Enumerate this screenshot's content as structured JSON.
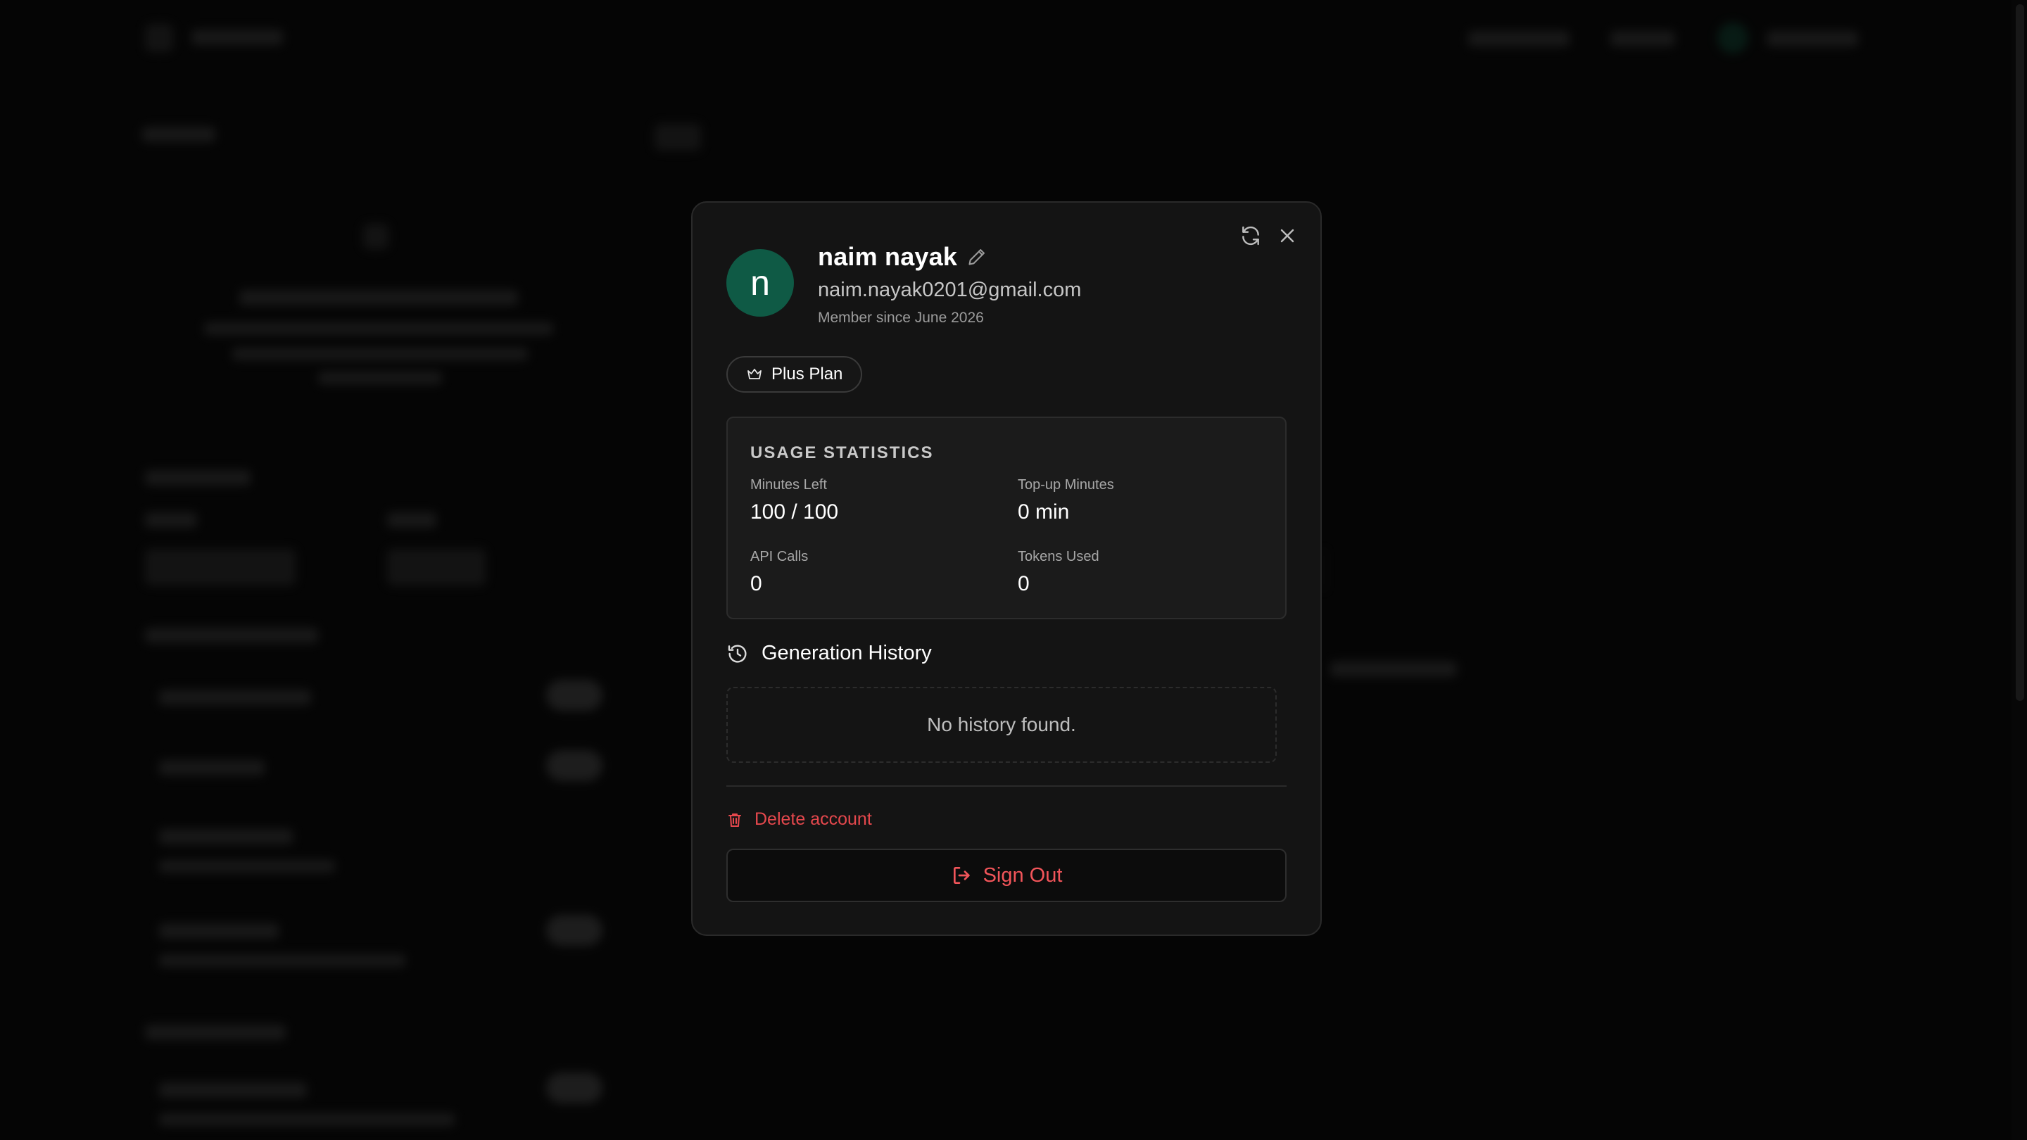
{
  "profile": {
    "avatar_initial": "n",
    "name": "naim nayak",
    "email": "naim.nayak0201@gmail.com",
    "member_since": "Member since June 2026"
  },
  "plan": {
    "label": "Plus Plan",
    "icon": "crown-icon"
  },
  "usage": {
    "title": "USAGE STATISTICS",
    "stats": [
      {
        "label": "Minutes Left",
        "value": "100 / 100"
      },
      {
        "label": "Top-up Minutes",
        "value": "0 min"
      },
      {
        "label": "API Calls",
        "value": "0"
      },
      {
        "label": "Tokens Used",
        "value": "0"
      }
    ]
  },
  "history": {
    "title": "Generation History",
    "empty_text": "No history found."
  },
  "actions": {
    "delete_account": "Delete account",
    "sign_out": "Sign Out"
  },
  "colors": {
    "avatar_bg": "#0f5a45",
    "danger": "#e5484d",
    "modal_bg": "#141414"
  }
}
